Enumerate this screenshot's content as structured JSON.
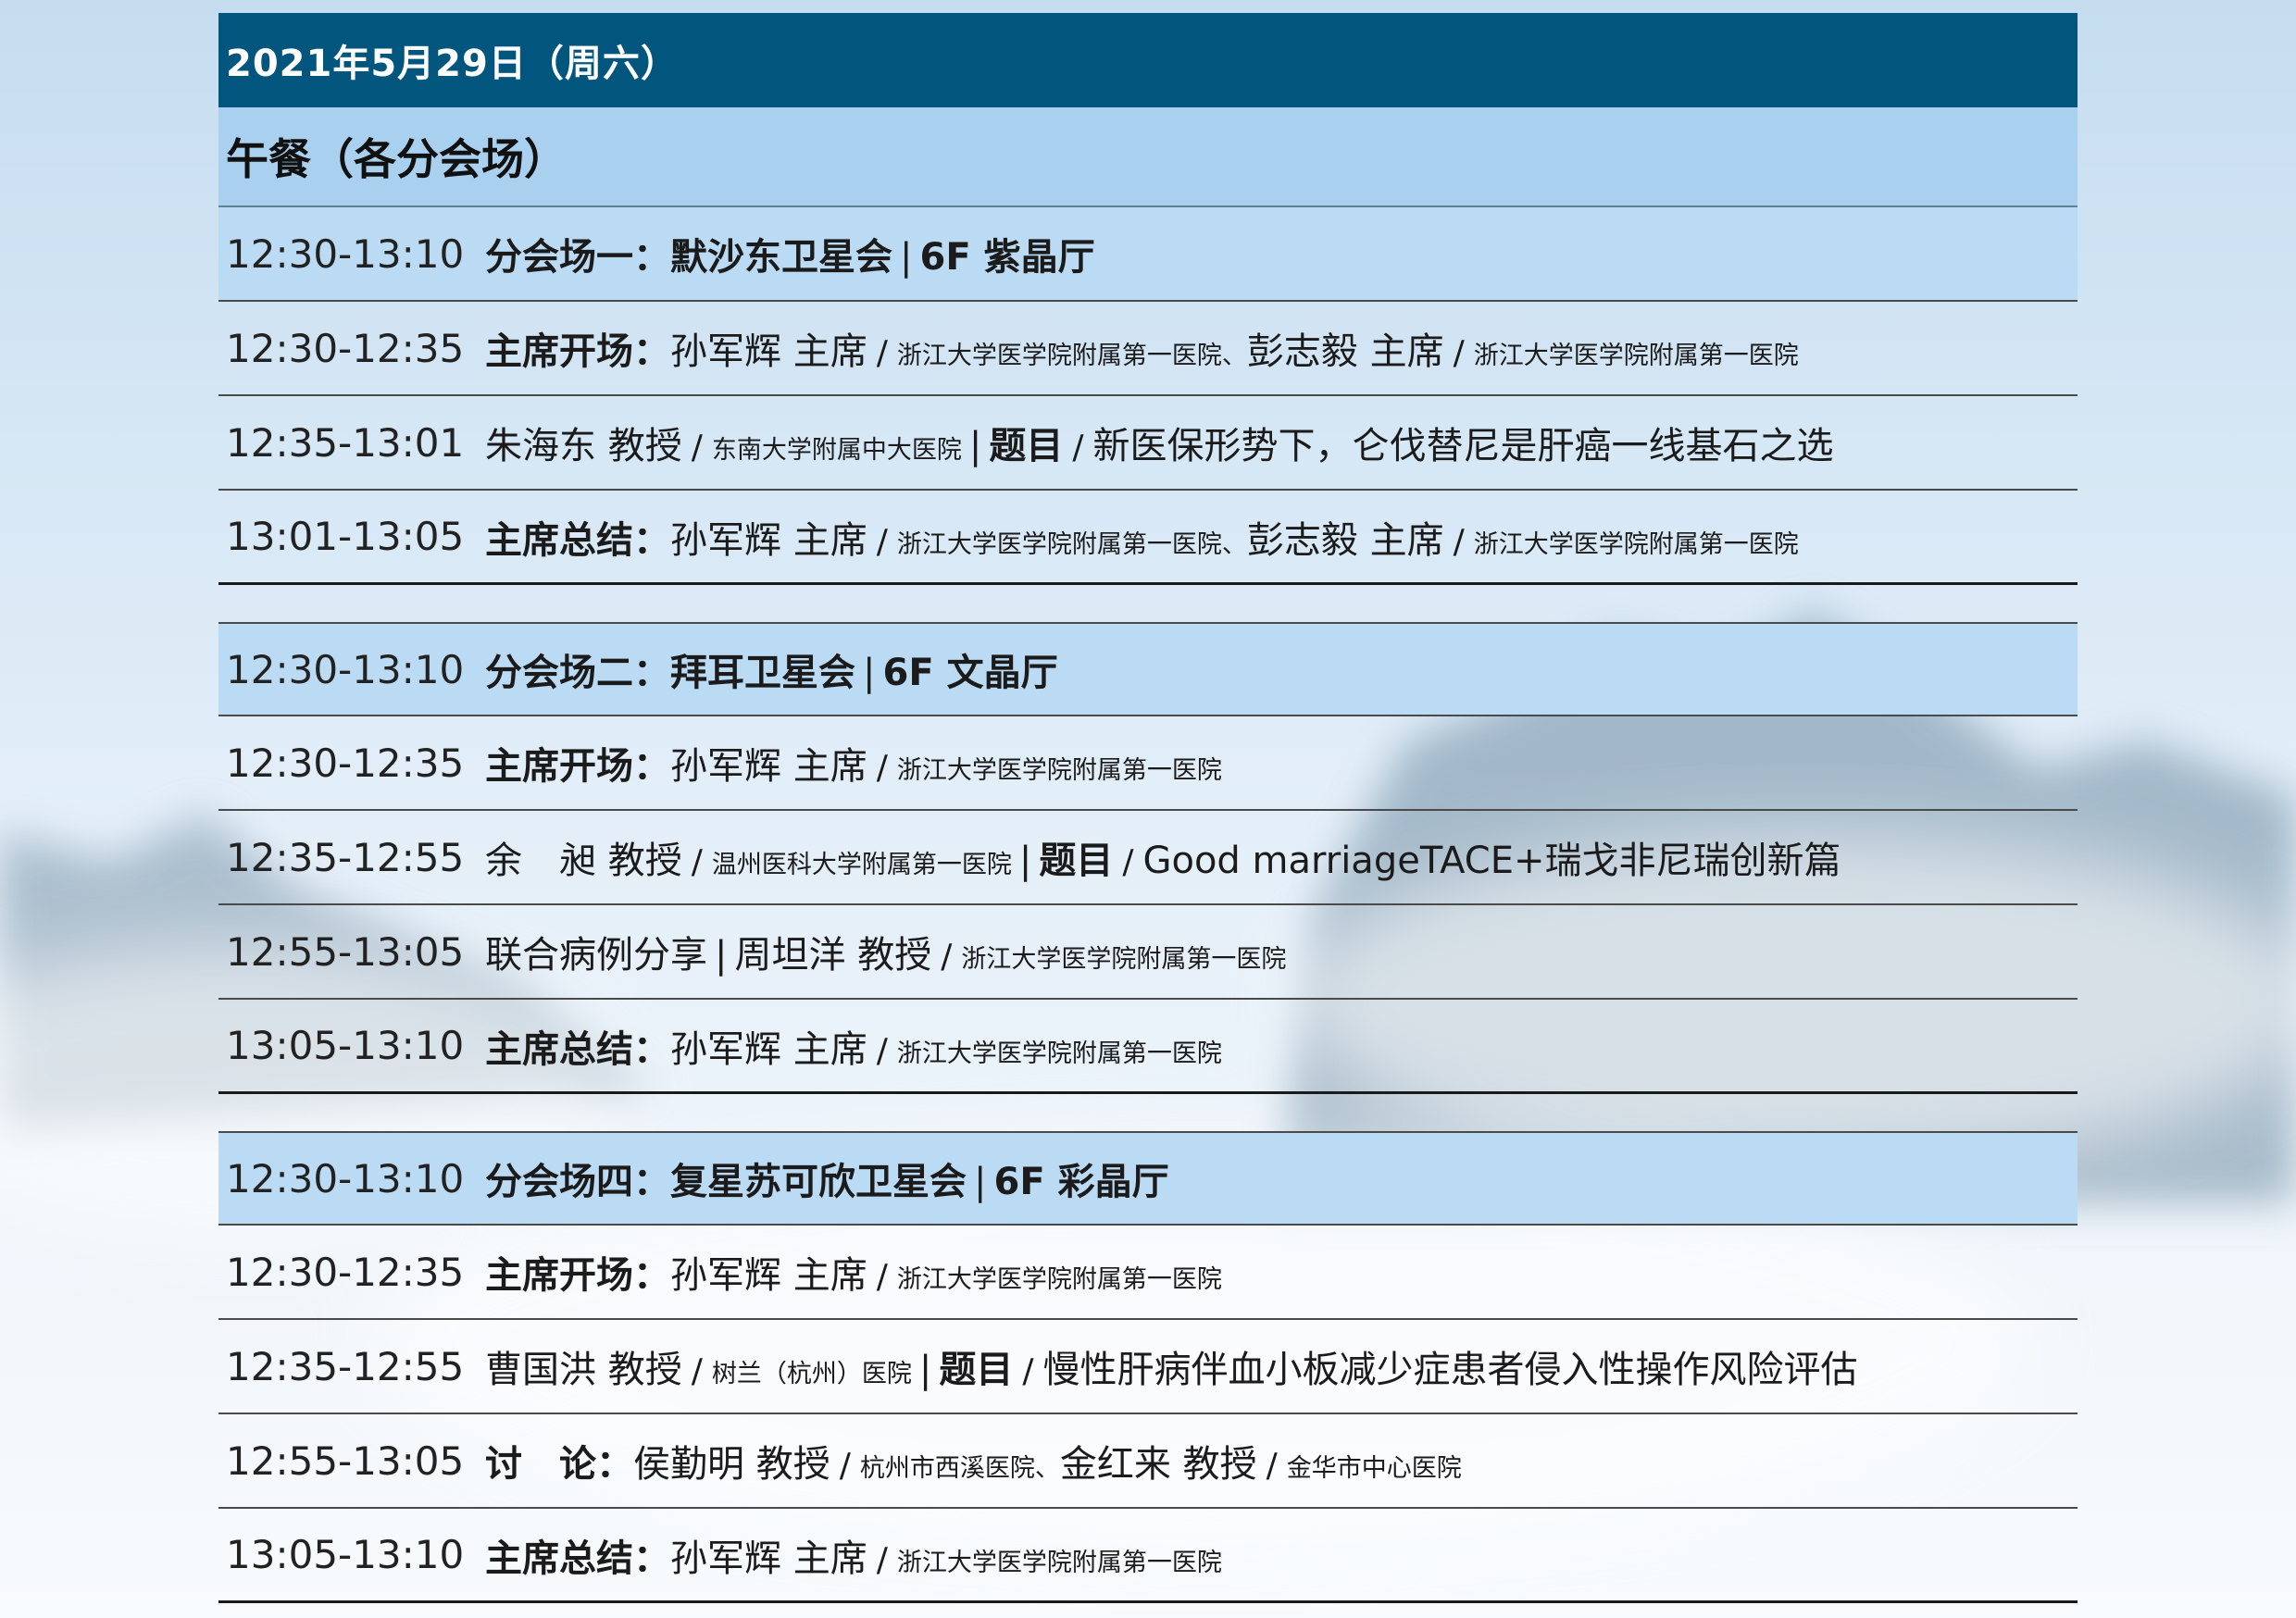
{
  "header": {
    "date": "2021年5月29日（周六）",
    "section_title": "午餐（各分会场）"
  },
  "sessions": [
    {
      "head": {
        "time": "12:30-13:10",
        "title": "分会场一：默沙东卫星会",
        "room": "6F 紫晶厅"
      },
      "rows": [
        {
          "time": "12:30-12:35",
          "label": "主席开场：",
          "p1_name": "孙军辉 主席",
          "p1_org": "浙江大学医学院附属第一医院、",
          "p2_name": "彭志毅 主席",
          "p2_org": "浙江大学医学院附属第一医院"
        },
        {
          "time": "12:35-13:01",
          "name": "朱海东 教授",
          "org": "东南大学附属中大医院",
          "topic_label": "题目",
          "topic": "新医保形势下，仑伐替尼是肝癌一线基石之选"
        },
        {
          "time": "13:01-13:05",
          "label": "主席总结：",
          "p1_name": "孙军辉 主席",
          "p1_org": "浙江大学医学院附属第一医院、",
          "p2_name": "彭志毅 主席",
          "p2_org": "浙江大学医学院附属第一医院"
        }
      ]
    },
    {
      "head": {
        "time": "12:30-13:10",
        "title": "分会场二：拜耳卫星会",
        "room": "6F 文晶厅"
      },
      "rows": [
        {
          "time": "12:30-12:35",
          "label": "主席开场：",
          "p1_name": "孙军辉 主席",
          "p1_org": "浙江大学医学院附属第一医院"
        },
        {
          "time": "12:35-12:55",
          "name": "余　昶 教授",
          "org": "温州医科大学附属第一医院",
          "topic_label": "题目",
          "topic": "Good marriageTACE+瑞戈非尼瑞创新篇"
        },
        {
          "time": "12:55-13:05",
          "label": "联合病例分享",
          "p1_name": "周坦洋 教授",
          "p1_org": "浙江大学医学院附属第一医院"
        },
        {
          "time": "13:05-13:10",
          "label": "主席总结：",
          "p1_name": "孙军辉 主席",
          "p1_org": "浙江大学医学院附属第一医院"
        }
      ]
    },
    {
      "head": {
        "time": "12:30-13:10",
        "title": "分会场四：复星苏可欣卫星会",
        "room": "6F 彩晶厅"
      },
      "rows": [
        {
          "time": "12:30-12:35",
          "label": "主席开场：",
          "p1_name": "孙军辉 主席",
          "p1_org": "浙江大学医学院附属第一医院"
        },
        {
          "time": "12:35-12:55",
          "name": "曹国洪 教授",
          "org": "树兰（杭州）医院",
          "topic_label": "题目",
          "topic": "慢性肝病伴血小板减少症患者侵入性操作风险评估"
        },
        {
          "time": "12:55-13:05",
          "label": "讨　论：",
          "p1_name": "侯勤明 教授",
          "p1_org": "杭州市西溪医院、",
          "p2_name": "金红来 教授",
          "p2_org": "金华市中心医院"
        },
        {
          "time": "13:05-13:10",
          "label": "主席总结：",
          "p1_name": "孙军辉 主席",
          "p1_org": "浙江大学医学院附属第一医院"
        }
      ]
    }
  ]
}
